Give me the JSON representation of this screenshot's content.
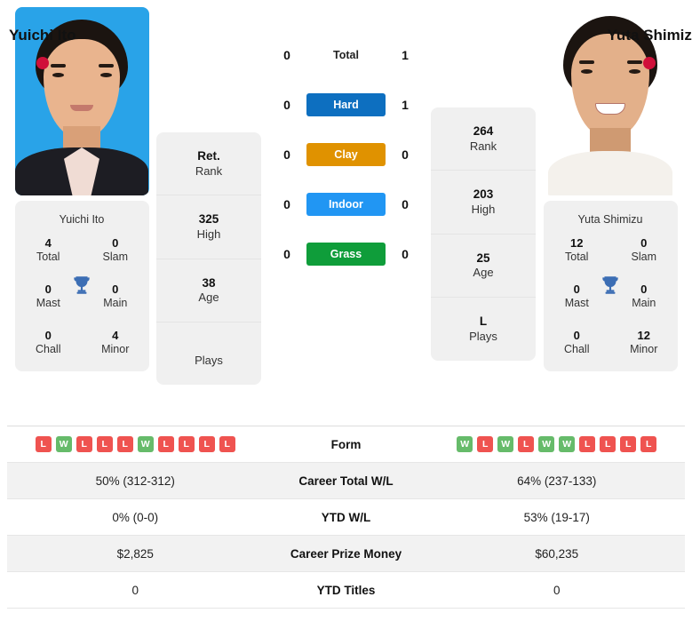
{
  "players": {
    "left": {
      "name": "Yuichi Ito",
      "flag": "japan-flag",
      "card_name": "Yuichi Ito",
      "titles": {
        "total_value": "4",
        "total_label": "Total",
        "slam_value": "0",
        "slam_label": "Slam",
        "mast_value": "0",
        "mast_label": "Mast",
        "main_value": "0",
        "main_label": "Main",
        "chall_value": "0",
        "chall_label": "Chall",
        "minor_value": "4",
        "minor_label": "Minor"
      },
      "profile": {
        "rank_value": "Ret.",
        "rank_label": "Rank",
        "high_value": "325",
        "high_label": "High",
        "age_value": "38",
        "age_label": "Age",
        "plays_value": "",
        "plays_label": "Plays"
      },
      "form": [
        "L",
        "W",
        "L",
        "L",
        "L",
        "W",
        "L",
        "L",
        "L",
        "L"
      ],
      "career_total_wl": "50% (312-312)",
      "ytd_wl": "0% (0-0)",
      "career_prize_money": "$2,825",
      "ytd_titles": "0"
    },
    "right": {
      "name": "Yuta Shimizu",
      "flag": "japan-flag",
      "card_name": "Yuta Shimizu",
      "titles": {
        "total_value": "12",
        "total_label": "Total",
        "slam_value": "0",
        "slam_label": "Slam",
        "mast_value": "0",
        "mast_label": "Mast",
        "main_value": "0",
        "main_label": "Main",
        "chall_value": "0",
        "chall_label": "Chall",
        "minor_value": "12",
        "minor_label": "Minor"
      },
      "profile": {
        "rank_value": "264",
        "rank_label": "Rank",
        "high_value": "203",
        "high_label": "High",
        "age_value": "25",
        "age_label": "Age",
        "plays_value": "L",
        "plays_label": "Plays"
      },
      "form": [
        "W",
        "L",
        "W",
        "L",
        "W",
        "W",
        "L",
        "L",
        "L",
        "L"
      ],
      "career_total_wl": "64% (237-133)",
      "ytd_wl": "53% (19-17)",
      "career_prize_money": "$60,235",
      "ytd_titles": "0"
    }
  },
  "head_to_head": {
    "rows": [
      {
        "left": "0",
        "label": "Total",
        "right": "1",
        "kind": "text"
      },
      {
        "left": "0",
        "label": "Hard",
        "right": "1",
        "kind": "badge",
        "color": "#0d6fc0"
      },
      {
        "left": "0",
        "label": "Clay",
        "right": "0",
        "kind": "badge",
        "color": "#e09200"
      },
      {
        "left": "0",
        "label": "Indoor",
        "right": "0",
        "kind": "badge",
        "color": "#2196f3"
      },
      {
        "left": "0",
        "label": "Grass",
        "right": "0",
        "kind": "badge",
        "color": "#0f9d3a"
      }
    ]
  },
  "stats_table": {
    "rows": [
      {
        "label": "Form",
        "type": "form",
        "shaded": false
      },
      {
        "label": "Career Total W/L",
        "type": "text",
        "shaded": true,
        "left": "50% (312-312)",
        "right": "64% (237-133)"
      },
      {
        "label": "YTD W/L",
        "type": "text",
        "shaded": false,
        "left": "0% (0-0)",
        "right": "53% (19-17)"
      },
      {
        "label": "Career Prize Money",
        "type": "text",
        "shaded": true,
        "left": "$2,825",
        "right": "$60,235"
      },
      {
        "label": "YTD Titles",
        "type": "text",
        "shaded": false,
        "left": "0",
        "right": "0"
      }
    ]
  },
  "colors": {
    "hard": "#0d6fc0",
    "clay": "#e09200",
    "indoor": "#2196f3",
    "grass": "#0f9d3a",
    "win": "#66bb6a",
    "loss": "#ef5350",
    "flag_red": "#d0103a",
    "trophy_blue": "#3c6eb4"
  }
}
